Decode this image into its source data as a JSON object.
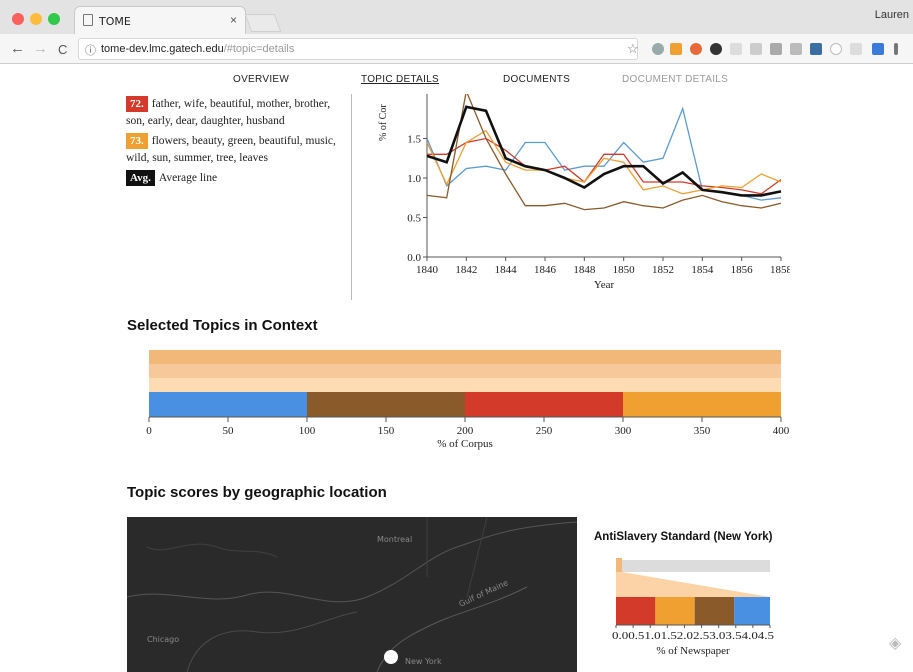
{
  "browser": {
    "tab_title": "TOME",
    "tab_close": "×",
    "user_label": "Lauren",
    "url_host": "tome-dev.lmc.gatech.edu",
    "url_hash": "/#topic=details",
    "back": "←",
    "forward": "→",
    "reload": "C",
    "info": "ⓘ",
    "star": "☆"
  },
  "nav": {
    "overview": "OVERVIEW",
    "topic_details": "TOPIC DETAILS",
    "documents": "DOCUMENTS",
    "document_details": "DOCUMENT DETAILS"
  },
  "legend": {
    "items": [
      {
        "badge": "72.",
        "color": "#d43a2a",
        "words": "father, wife, beautiful, mother, brother, son, early, dear, daughter, husband"
      },
      {
        "badge": "73.",
        "color": "#f0a030",
        "words": "flowers, beauty, green, beautiful, music, wild, sun, summer, tree, leaves"
      },
      {
        "badge": "Avg.",
        "color": "#111111",
        "words": "Average line"
      }
    ]
  },
  "chart_data": [
    {
      "type": "line",
      "title": "",
      "xlabel": "Year",
      "ylabel": "% of Corpus",
      "ylabel_visible": "% of Cor",
      "xlim": [
        1840,
        1858
      ],
      "ylim": [
        0,
        2.0
      ],
      "x_ticks": [
        "1840",
        "1842",
        "1844",
        "1846",
        "1848",
        "1850",
        "1852",
        "1854",
        "1856",
        "1858"
      ],
      "y_ticks": [
        "0.0",
        "0.5",
        "1.0",
        "1.5"
      ],
      "x": [
        1840,
        1841,
        1842,
        1843,
        1844,
        1845,
        1846,
        1847,
        1848,
        1849,
        1850,
        1851,
        1852,
        1853,
        1854,
        1855,
        1856,
        1857,
        1858
      ],
      "series": [
        {
          "color": "#5b9bd5",
          "values": [
            1.5,
            0.9,
            1.12,
            1.15,
            1.1,
            1.45,
            1.45,
            1.1,
            1.15,
            1.15,
            1.45,
            1.2,
            1.25,
            1.88,
            0.85,
            0.82,
            0.78,
            0.72,
            0.75
          ]
        },
        {
          "color": "#d43a2a",
          "values": [
            1.3,
            1.3,
            1.45,
            1.5,
            1.35,
            1.15,
            1.1,
            1.15,
            0.95,
            1.3,
            1.3,
            0.95,
            0.95,
            0.95,
            0.9,
            0.88,
            0.85,
            0.8,
            0.98
          ]
        },
        {
          "color": "#f0a030",
          "values": [
            1.45,
            0.92,
            1.45,
            1.6,
            1.2,
            1.1,
            1.1,
            1.0,
            0.95,
            1.25,
            1.2,
            0.85,
            0.9,
            0.8,
            0.85,
            0.9,
            0.88,
            1.05,
            0.95
          ]
        },
        {
          "color": "#8b5a2b",
          "values": [
            0.78,
            0.75,
            2.1,
            1.5,
            1.05,
            0.65,
            0.65,
            0.68,
            0.6,
            0.62,
            0.7,
            0.65,
            0.62,
            0.72,
            0.78,
            0.7,
            0.65,
            0.62,
            0.68
          ]
        },
        {
          "color": "#111111",
          "width": 2.6,
          "values": [
            1.28,
            1.2,
            1.9,
            1.85,
            1.25,
            1.15,
            1.1,
            1.0,
            0.88,
            1.05,
            1.15,
            1.15,
            0.93,
            1.07,
            0.85,
            0.82,
            0.78,
            0.78,
            0.83
          ]
        }
      ]
    },
    {
      "type": "bar",
      "orientation": "horizontal-stacked",
      "xlabel": "% of Corpus",
      "xlim": [
        0,
        400
      ],
      "x_ticks": [
        "0",
        "50",
        "100",
        "150",
        "200",
        "250",
        "300",
        "350",
        "400"
      ],
      "background_bands": [
        "#f2b879",
        "#f7c99a",
        "#fddcb4"
      ],
      "segments": [
        {
          "color": "#4a90e2",
          "from": 0,
          "to": 100
        },
        {
          "color": "#8b5a2b",
          "from": 100,
          "to": 200
        },
        {
          "color": "#d43a2a",
          "from": 200,
          "to": 300
        },
        {
          "color": "#f0a030",
          "from": 300,
          "to": 400
        }
      ]
    },
    {
      "type": "bar",
      "orientation": "horizontal-stacked",
      "xlabel": "% of Newspaper",
      "xlim": [
        0,
        4.5
      ],
      "x_ticks": [
        "0.0",
        "0.5",
        "1.0",
        "1.5",
        "2.0",
        "2.5",
        "3.0",
        "3.5",
        "4.0",
        "4.5"
      ],
      "segments": [
        {
          "color": "#d43a2a",
          "from": 0,
          "to": 1.15
        },
        {
          "color": "#f0a030",
          "from": 1.15,
          "to": 2.3
        },
        {
          "color": "#8b5a2b",
          "from": 2.3,
          "to": 3.45
        },
        {
          "color": "#4a90e2",
          "from": 3.45,
          "to": 4.5
        }
      ],
      "highlight_color": "#f2b879"
    }
  ],
  "sections": {
    "context_title": "Selected Topics in Context",
    "geo_title": "Topic scores by geographic location"
  },
  "map": {
    "labels": [
      "Montreal",
      "Gulf of Maine",
      "Chicago",
      "New York"
    ],
    "newspaper_title": "AntiSlavery Standard (New York)"
  },
  "colors": {
    "blue": "#4a90e2",
    "brown": "#8b5a2b",
    "red": "#d43a2a",
    "orange": "#f0a030"
  }
}
